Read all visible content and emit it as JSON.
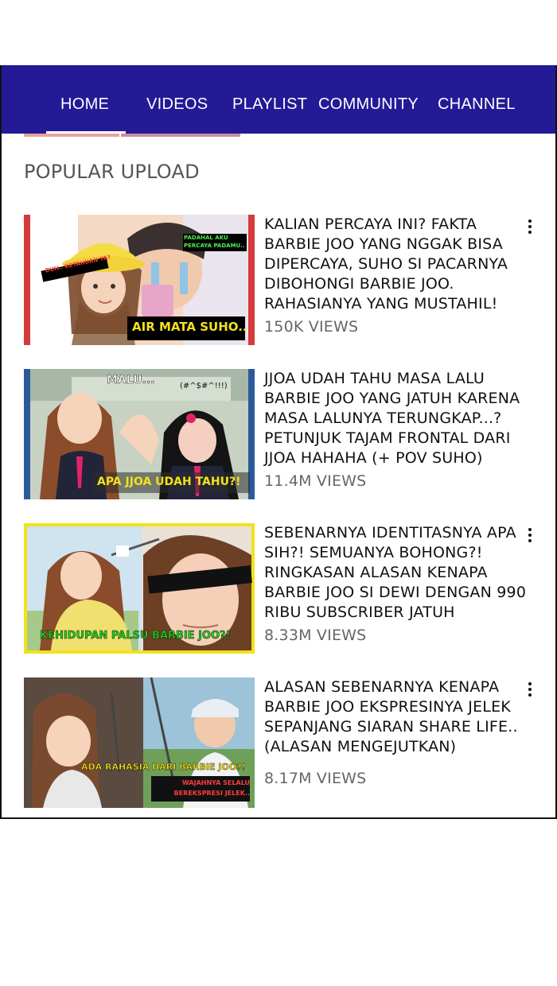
{
  "nav": {
    "tabs": [
      {
        "label": "HOME",
        "active": true
      },
      {
        "label": "VIDEOS"
      },
      {
        "label": "PLAYLIST"
      },
      {
        "label": "COMMUNITY"
      },
      {
        "label": "CHANNEL"
      }
    ],
    "background": "#241a96"
  },
  "section": {
    "title": "POPULAR UPLOAD"
  },
  "videos": [
    {
      "title": "KALIAN PERCAYA INI? FAKTA BARBIE JOO YANG NGGAK BISA DIPERCAYA, SUHO SI PACARNYA DIBOHONGI BARBIE JOO. RAHASIANYA YANG MUSTAHIL!",
      "views": "150K VIEWS",
      "thumb_caption": "AIR MATA SUHO..",
      "bubble_left": "DUH.. KETAHUAN YA?",
      "bubble_right": "PADAHAL AKU PERCAYA PADAMU..",
      "frame_color": "#d63b3b"
    },
    {
      "title": "JJOA UDAH TAHU MASA LALU BARBIE JOO YANG JATUH KARENA MASA LALUNYA TERUNGKAP...? PETUNJUK TAJAM FRONTAL DARI JJOA HAHAHA (+ POV SUHO)",
      "views": "11.4M VIEWS",
      "thumb_caption": "APA JJOA UDAH TAHU?!",
      "bubble_left": "MALU...",
      "bubble_right": "(#^$#^!!!)",
      "frame_color": "#2a5a9c"
    },
    {
      "title": "SEBENARNYA IDENTITASNYA APA SIH?! SEMUANYA BOHONG?! RINGKASAN ALASAN KENAPA BARBIE JOO SI DEWI DENGAN 990 RIBU SUBSCRIBER JATUH",
      "views": "8.33M VIEWS",
      "thumb_caption": "KEHIDUPAN PALSU BARBIE JOO?!",
      "frame_color": "#f2e21b"
    },
    {
      "title": "ALASAN SEBENARNYA KENAPA BARBIE JOO EKSPRESINYA JELEK SEPANJANG SIARAN SHARE LIFE.. (ALASAN MENGEJUTKAN)",
      "views": "8.17M VIEWS",
      "thumb_caption": "ADA RAHASIA DARI BARBIE JOO?!",
      "thumb_caption2": "WAJAHNYA SELALU BEREKSPRESI JELEK..",
      "frame_color": "#333333"
    }
  ]
}
